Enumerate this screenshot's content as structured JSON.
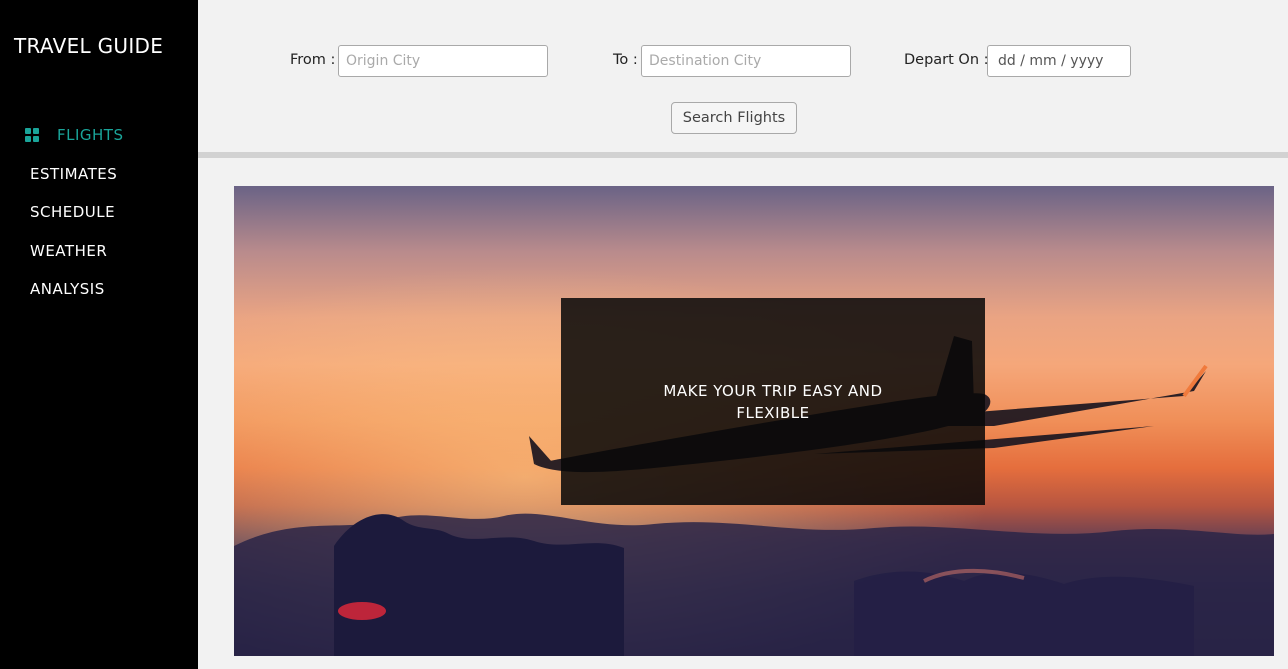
{
  "sidebar": {
    "brand": "TRAVEL GUIDE",
    "items": [
      {
        "label": "FLIGHTS",
        "active": true
      },
      {
        "label": "ESTIMATES",
        "active": false
      },
      {
        "label": "SCHEDULE",
        "active": false
      },
      {
        "label": "WEATHER",
        "active": false
      },
      {
        "label": "ANALYSIS",
        "active": false
      }
    ],
    "accent_color": "#1aa59a"
  },
  "search": {
    "from_label": "From :",
    "from_placeholder": "Origin City",
    "to_label": "To :",
    "to_placeholder": "Destination City",
    "depart_label": "Depart On :",
    "depart_placeholder": "dd / mm / yyyy",
    "button_label": "Search Flights"
  },
  "hero": {
    "tagline": "MAKE YOUR TRIP EASY AND FLEXIBLE"
  }
}
